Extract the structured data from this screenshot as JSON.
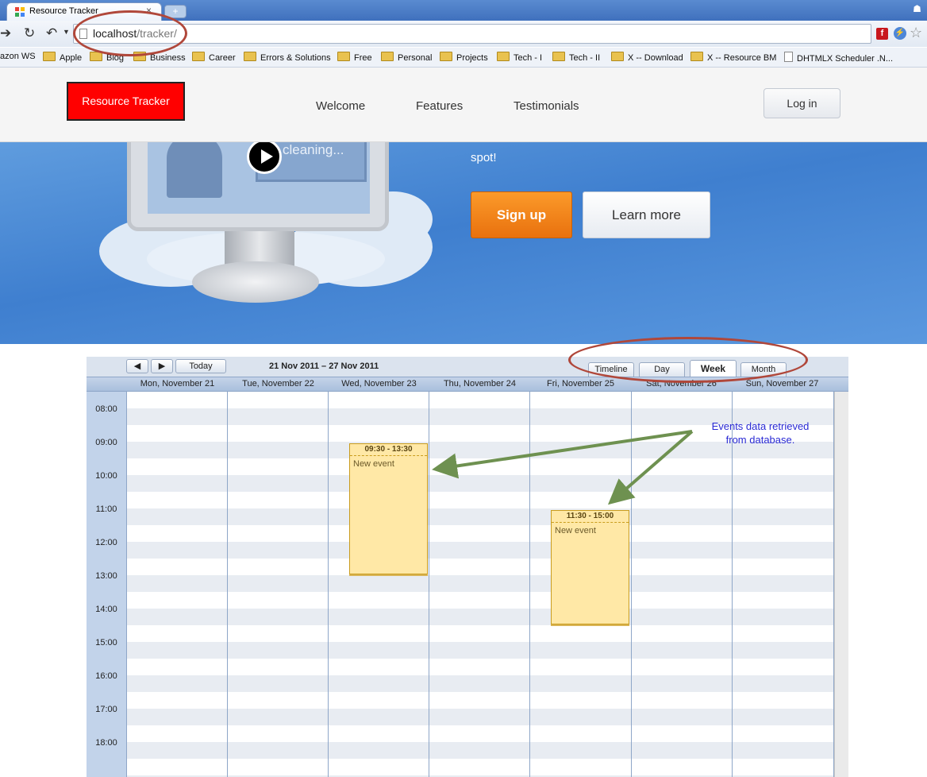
{
  "browser": {
    "tab_title": "Resource Tracker",
    "tab_close": "×",
    "new_tab": "+",
    "url_host": "localhost",
    "url_path": "/tracker/",
    "bookmarks": [
      "azon WS",
      "Apple",
      "Blog",
      "Business",
      "Career",
      "Errors & Solutions",
      "Free",
      "Personal",
      "Projects",
      "Tech - I",
      "Tech - II",
      "X -- Download",
      "X -- Resource BM",
      "DHTMLX Scheduler .N..."
    ]
  },
  "site": {
    "logo": "Resource Tracker",
    "nav": [
      "Welcome",
      "Features",
      "Testimonials"
    ],
    "login": "Log in"
  },
  "hero": {
    "video_overlay_text": "cleaning...",
    "tagline_fragment": "spot!",
    "signup": "Sign up",
    "learn_more": "Learn more"
  },
  "scheduler": {
    "today": "Today",
    "prev": "◀",
    "next": "▶",
    "date_range": "21 Nov 2011 – 27 Nov 2011",
    "views": [
      "Timeline",
      "Day",
      "Week",
      "Month"
    ],
    "active_view": "Week",
    "days": [
      "Mon, November 21",
      "Tue, November 22",
      "Wed, November 23",
      "Thu, November 24",
      "Fri, November 25",
      "Sat, November 26",
      "Sun, November 27"
    ],
    "hours": [
      "08:00",
      "09:00",
      "10:00",
      "11:00",
      "12:00",
      "13:00",
      "14:00",
      "15:00",
      "16:00",
      "17:00",
      "18:00"
    ],
    "events": [
      {
        "time": "09:30 - 13:30",
        "text": "New event",
        "day": "Wed, November 23"
      },
      {
        "time": "11:30 - 15:00",
        "text": "New event",
        "day": "Fri, November 25"
      }
    ]
  },
  "annotations": {
    "note_line1": "Events data retrieved",
    "note_line2": "from database.",
    "ring_color": "#b0473a",
    "arrow_color": "#6e9150",
    "note_color": "#2929d4"
  }
}
